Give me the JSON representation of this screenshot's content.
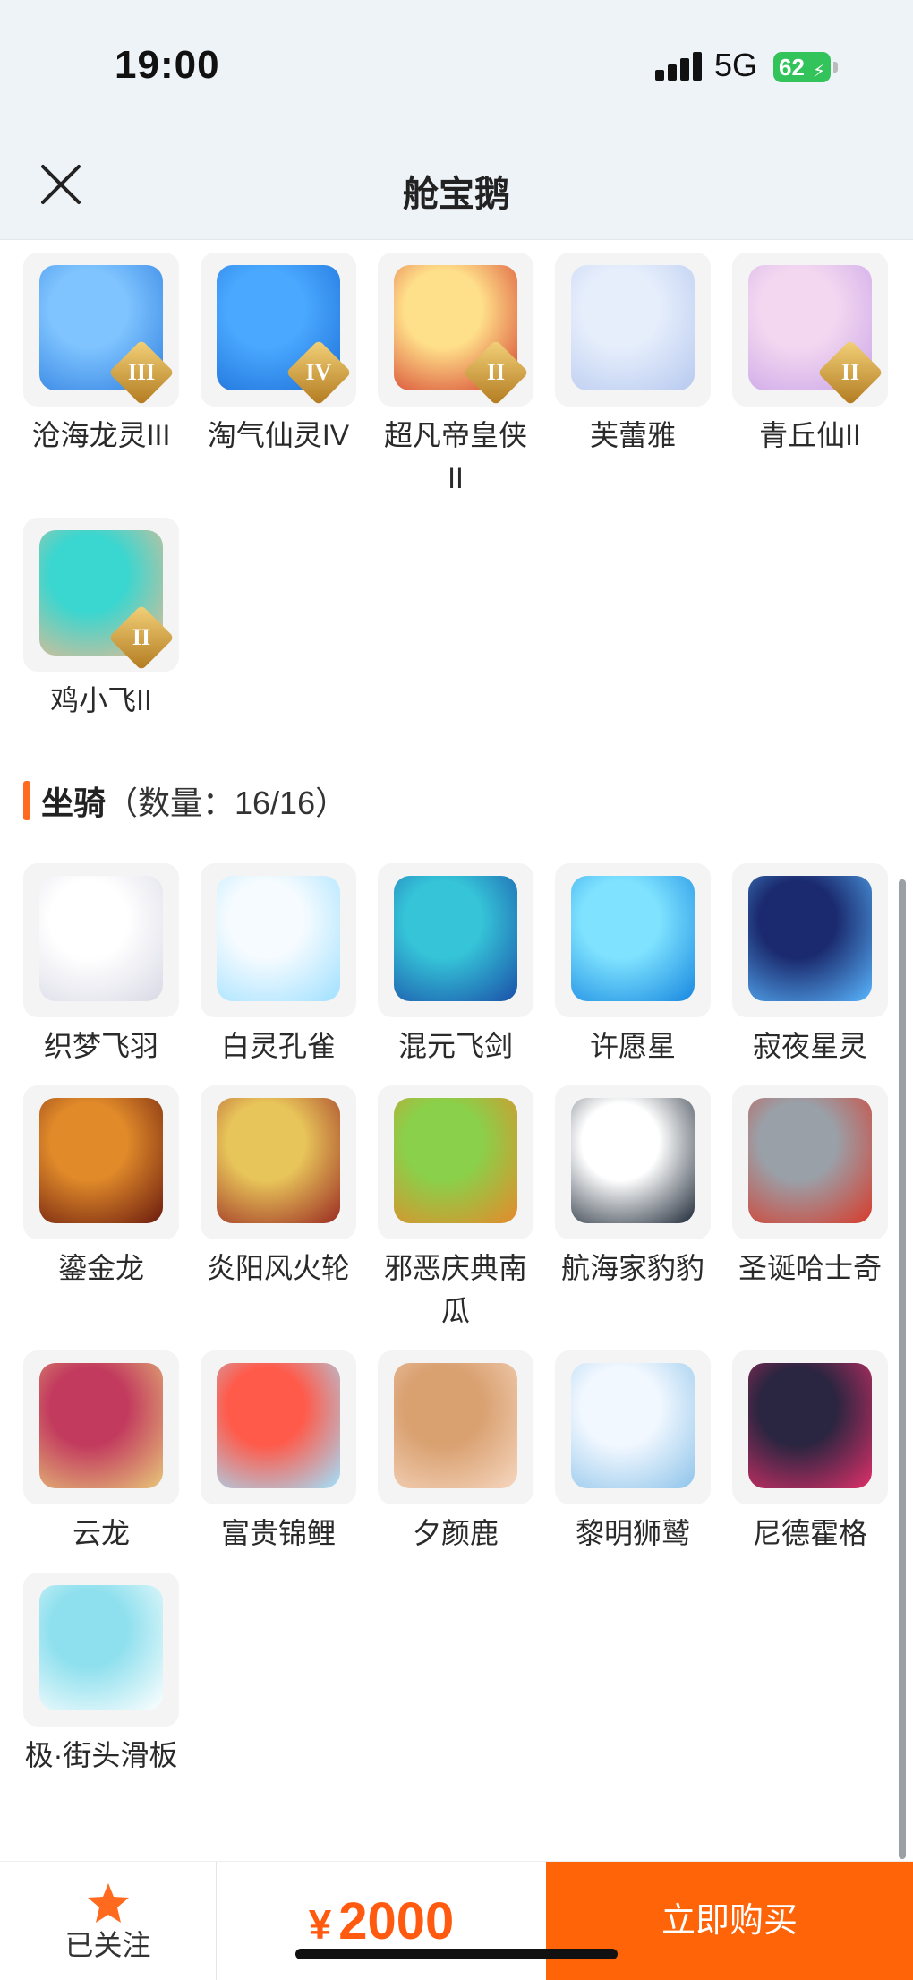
{
  "status": {
    "time": "19:00",
    "network": "5G",
    "battery": "62"
  },
  "nav": {
    "title": "舱宝鹅",
    "close_icon": "close-icon"
  },
  "pets": [
    {
      "name": "沧海龙灵III",
      "rank": "III",
      "art": "dragon-spirit",
      "colors": [
        "#7fc4ff",
        "#2f7fe0"
      ]
    },
    {
      "name": "淘气仙灵IV",
      "rank": "IV",
      "art": "blue-puppy",
      "colors": [
        "#4aa8ff",
        "#1b6fd6"
      ]
    },
    {
      "name": "超凡帝皇侠II",
      "rank": "II",
      "art": "golden-warrior",
      "colors": [
        "#ffe08a",
        "#d33a2b"
      ]
    },
    {
      "name": "芙蕾雅",
      "rank": "",
      "art": "white-haired-girl",
      "colors": [
        "#e6eefc",
        "#b7c9ef"
      ]
    },
    {
      "name": "青丘仙II",
      "rank": "II",
      "art": "fox-fairy",
      "colors": [
        "#f3d7f0",
        "#c9a4e8"
      ]
    },
    {
      "name": "鸡小飞II",
      "rank": "II",
      "art": "chick-bodybuilder",
      "colors": [
        "#3ad6d0",
        "#f0b98e"
      ]
    }
  ],
  "mounts_section": {
    "title": "坐骑",
    "count": "（数量：16/16）"
  },
  "mounts": [
    {
      "name": "织梦飞羽",
      "art": "white-feather",
      "colors": [
        "#ffffff",
        "#d9d9e6"
      ]
    },
    {
      "name": "白灵孔雀",
      "art": "white-peacock",
      "colors": [
        "#f5fbff",
        "#9fe0ff"
      ]
    },
    {
      "name": "混元飞剑",
      "art": "flying-sword",
      "colors": [
        "#35c4d8",
        "#1a4fa8"
      ]
    },
    {
      "name": "许愿星",
      "art": "wish-star",
      "colors": [
        "#7fe3ff",
        "#1787e0"
      ]
    },
    {
      "name": "寂夜星灵",
      "art": "night-star-wolf",
      "colors": [
        "#1b2a6e",
        "#59b7ff"
      ]
    },
    {
      "name": "鎏金龙",
      "art": "gilded-dragon",
      "colors": [
        "#e08a2a",
        "#6a1a0e"
      ]
    },
    {
      "name": "炎阳风火轮",
      "art": "fire-wheel",
      "colors": [
        "#e8c55a",
        "#9a2a22"
      ]
    },
    {
      "name": "邪恶庆典南瓜",
      "art": "evil-pumpkin",
      "colors": [
        "#8ad04a",
        "#e6892a"
      ]
    },
    {
      "name": "航海家豹豹",
      "art": "pirate-bear",
      "colors": [
        "#ffffff",
        "#1f2a38"
      ]
    },
    {
      "name": "圣诞哈士奇",
      "art": "christmas-husky",
      "colors": [
        "#9aa0a8",
        "#d83a2a"
      ]
    },
    {
      "name": "云龙",
      "art": "cloud-dragon",
      "colors": [
        "#c23a5e",
        "#e8c87a"
      ]
    },
    {
      "name": "富贵锦鲤",
      "art": "koi-fish",
      "colors": [
        "#ff5a4a",
        "#9fe3ff"
      ]
    },
    {
      "name": "夕颜鹿",
      "art": "dusk-deer",
      "colors": [
        "#d9a070",
        "#f6d7c0"
      ]
    },
    {
      "name": "黎明狮鹫",
      "art": "dawn-griffin",
      "colors": [
        "#f2f8ff",
        "#8ec4ea"
      ]
    },
    {
      "name": "尼德霍格",
      "art": "nidhogg-dragon",
      "colors": [
        "#2a2540",
        "#e0306a"
      ]
    },
    {
      "name": "极·街头滑板",
      "art": "street-skateboard",
      "colors": [
        "#8fe0ee",
        "#ffffff"
      ]
    }
  ],
  "bottom": {
    "follow_label": "已关注",
    "currency": "¥",
    "price": "2000",
    "buy_label": "立即购买"
  }
}
